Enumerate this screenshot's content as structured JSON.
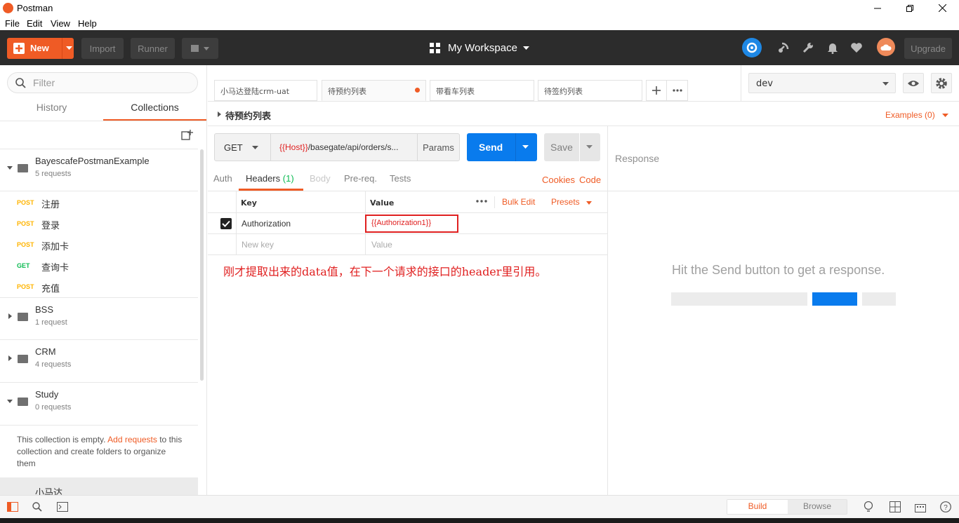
{
  "window": {
    "title": "Postman"
  },
  "menu": [
    "File",
    "Edit",
    "View",
    "Help"
  ],
  "header": {
    "new_label": "New",
    "import_label": "Import",
    "runner_label": "Runner",
    "workspace_label": "My Workspace",
    "upgrade_label": "Upgrade",
    "accent": "#ef5b25"
  },
  "sidebar": {
    "filter_placeholder": "Filter",
    "tabs": {
      "history": "History",
      "collections": "Collections"
    },
    "collections": [
      {
        "name": "BayescafePostmanExample",
        "count": "5 requests",
        "requests": [
          {
            "method": "POST",
            "name": "注册"
          },
          {
            "method": "POST",
            "name": "登录"
          },
          {
            "method": "POST",
            "name": "添加卡"
          },
          {
            "method": "GET",
            "name": "查询卡"
          },
          {
            "method": "POST",
            "name": "充值"
          }
        ]
      },
      {
        "name": "BSS",
        "count": "1 request"
      },
      {
        "name": "CRM",
        "count": "4 requests"
      },
      {
        "name": "Study",
        "count": "0 requests"
      }
    ],
    "empty_message": {
      "before": "This collection is empty. ",
      "link": "Add requests",
      "after": " to this collection and create folders to organize them"
    },
    "next_collection": "小马达"
  },
  "tabs": [
    {
      "label": "小马达登陆crm-uat"
    },
    {
      "label": "待预约列表"
    },
    {
      "label": "带看车列表"
    },
    {
      "label": "待签约列表"
    }
  ],
  "environment": {
    "selected": "dev"
  },
  "request": {
    "name": "待预约列表",
    "examples_label": "Examples (0)",
    "method": "GET",
    "url_var": "{{Host}}",
    "url_rest": "/basegate/api/orders/s...",
    "params_label": "Params",
    "send_label": "Send",
    "save_label": "Save",
    "subtabs": {
      "auth": "Auth",
      "headers": "Headers",
      "headers_count": "(1)",
      "body": "Body",
      "prereq": "Pre-req.",
      "tests": "Tests",
      "cookies": "Cookies",
      "code": "Code"
    },
    "headers_table": {
      "col_key": "Key",
      "col_value": "Value",
      "bulk_edit": "Bulk Edit",
      "presets": "Presets",
      "rows": [
        {
          "key": "Authorization",
          "value": "{{Authorization1}}",
          "checked": true
        }
      ],
      "new_key_placeholder": "New key",
      "new_value_placeholder": "Value"
    },
    "annotation": "刚才提取出来的data值，在下一个请求的接口的header里引用。"
  },
  "response": {
    "label": "Response",
    "hint": "Hit the Send button to get a response."
  },
  "statusbar": {
    "build_label": "Build",
    "browse_label": "Browse"
  }
}
